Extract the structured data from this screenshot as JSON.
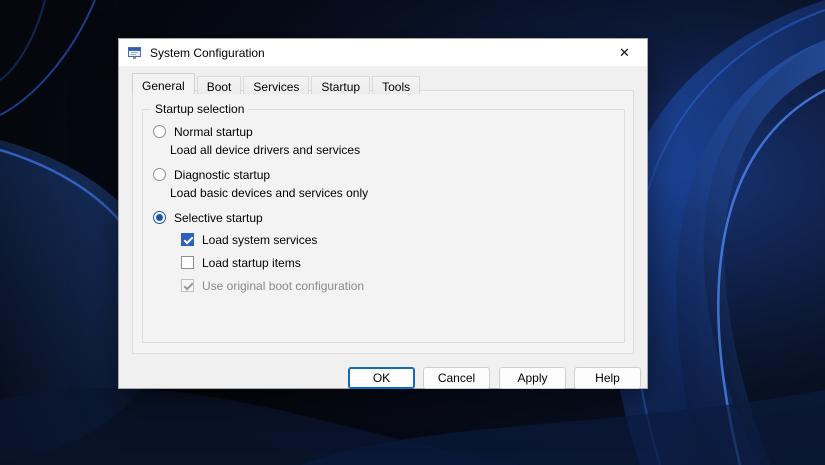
{
  "window": {
    "title": "System Configuration",
    "close_glyph": "✕"
  },
  "tabs": [
    {
      "label": "General",
      "active": true
    },
    {
      "label": "Boot",
      "active": false
    },
    {
      "label": "Services",
      "active": false
    },
    {
      "label": "Startup",
      "active": false
    },
    {
      "label": "Tools",
      "active": false
    }
  ],
  "general_tab": {
    "group_label": "Startup selection",
    "radios": [
      {
        "label": "Normal startup",
        "description": "Load all device drivers and services",
        "selected": false
      },
      {
        "label": "Diagnostic startup",
        "description": "Load basic devices and services only",
        "selected": false
      },
      {
        "label": "Selective startup",
        "description": "",
        "selected": true
      }
    ],
    "checkboxes": [
      {
        "label": "Load system services",
        "checked": true,
        "disabled": false
      },
      {
        "label": "Load startup items",
        "checked": false,
        "disabled": false
      },
      {
        "label": "Use original boot configuration",
        "checked": true,
        "disabled": true
      }
    ]
  },
  "buttons": [
    {
      "label": "OK",
      "default": true
    },
    {
      "label": "Cancel",
      "default": false
    },
    {
      "label": "Apply",
      "default": false
    },
    {
      "label": "Help",
      "default": false
    }
  ],
  "colors": {
    "accent": "#1a54b0",
    "checkbox_fill": "#2b5fc0",
    "dialog_bg": "#f0f0f0",
    "titlebar_bg": "#ffffff"
  }
}
